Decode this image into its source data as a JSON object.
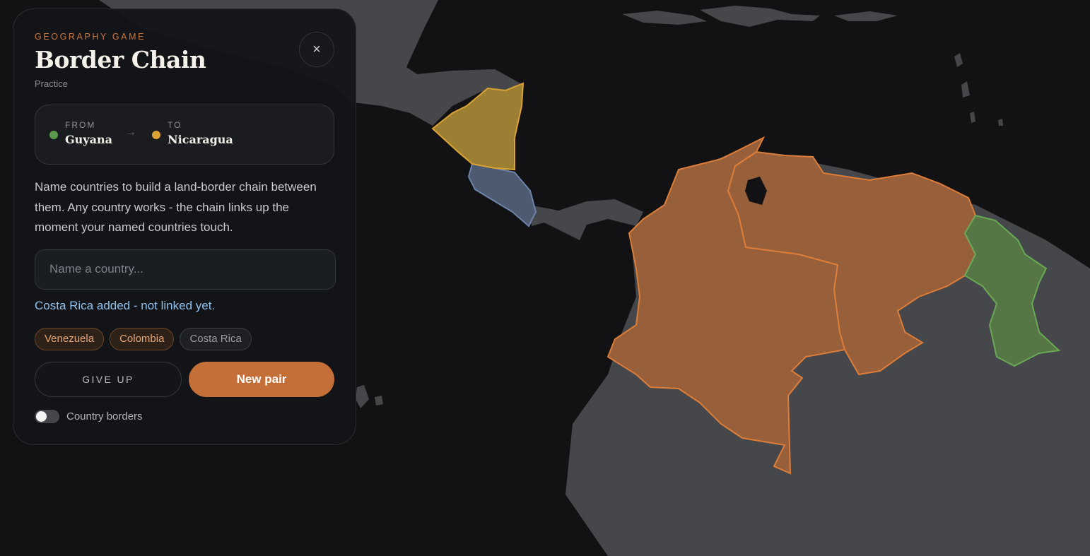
{
  "header": {
    "eyebrow": "GEOGRAPHY GAME",
    "title": "Border Chain",
    "mode": "Practice",
    "close_symbol": "×"
  },
  "pair": {
    "from_label": "FROM",
    "from_value": "Guyana",
    "from_color": "#5b9a4c",
    "arrow": "→",
    "to_label": "TO",
    "to_value": "Nicaragua",
    "to_color": "#d9a233"
  },
  "description": "Name countries to build a land-border chain between them. Any country works - the chain links up the moment your named countries touch.",
  "input": {
    "placeholder": "Name a country...",
    "value": ""
  },
  "status": "Costa Rica added - not linked yet.",
  "named_countries": [
    {
      "name": "Venezuela",
      "state": "linked"
    },
    {
      "name": "Colombia",
      "state": "linked"
    },
    {
      "name": "Costa Rica",
      "state": "loose"
    }
  ],
  "actions": {
    "give_up": "GIVE UP",
    "new_pair": "New pair"
  },
  "toggle": {
    "label": "Country borders",
    "on": false
  },
  "map": {
    "colors": {
      "ocean": "#121214",
      "land": "#46474a",
      "chain": "#98603a",
      "chain_border": "#dc7d3a",
      "from": "#567745",
      "from_border": "#69a955",
      "to": "#9d7f34",
      "to_border": "#d9a233",
      "loose": "#4d5a70",
      "loose_border": "#6d84a8"
    }
  }
}
